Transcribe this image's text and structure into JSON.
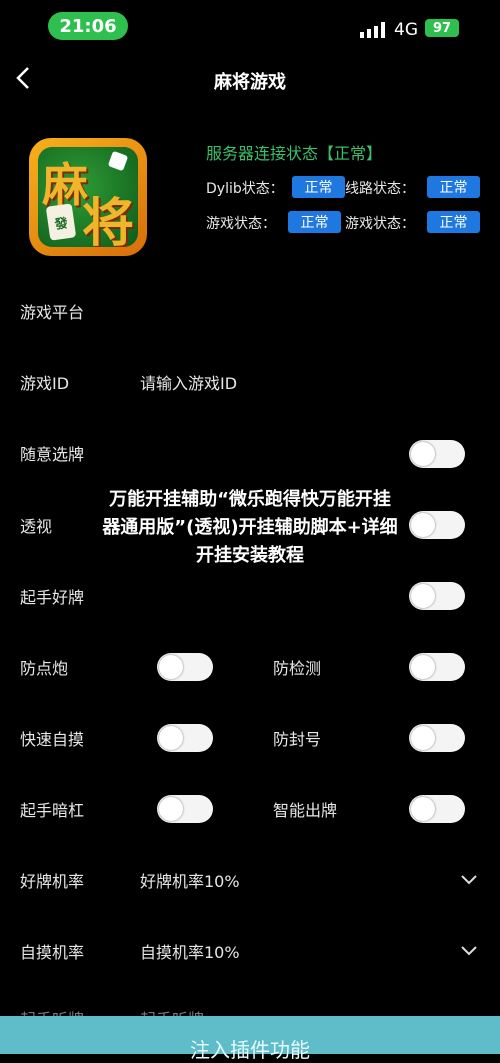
{
  "status_bar": {
    "time": "21:06",
    "network": "4G",
    "battery": "97"
  },
  "nav": {
    "title": "麻将游戏"
  },
  "logo": {
    "char1": "麻",
    "char2": "将",
    "tile": "發"
  },
  "server": {
    "status_text": "服务器连接状态【正常】",
    "dylib_label": "Dylib状态：",
    "dylib_value": "正常",
    "line_label": "线路状态：",
    "line_value": "正常",
    "game_label": "游戏状态：",
    "game_value": "正常",
    "game2_label": "游戏状态：",
    "game2_value": "正常"
  },
  "settings": {
    "platform_label": "游戏平台",
    "game_id_label": "游戏ID",
    "game_id_placeholder": "请输入游戏ID",
    "random_tile_label": "随意选牌",
    "see_through_label": "透视",
    "good_hand_label": "起手好牌",
    "anti_discard_label": "防点炮",
    "anti_detect_label": "防检测",
    "quick_self_draw_label": "快速自摸",
    "anti_ban_label": "防封号",
    "hidden_kong_label": "起手暗杠",
    "smart_play_label": "智能出牌",
    "good_tile_rate_label": "好牌机率",
    "good_tile_rate_value": "好牌机率10%",
    "self_draw_rate_label": "自摸机率",
    "self_draw_rate_value": "自摸机率10%",
    "cut_left": "起手听牌",
    "cut_right": "起手听牌"
  },
  "overlay": {
    "line1": "万能开挂辅助“微乐跑得快万能开挂",
    "line2": "器通用版”(透视)开挂辅助脚本+详细",
    "line3": "开挂安装教程"
  },
  "footer": {
    "inject_label": "注入插件功能"
  },
  "colors": {
    "accent_blue": "#1e78e0",
    "status_green": "#3bbf6a",
    "footer_teal": "#5fbcc9"
  }
}
